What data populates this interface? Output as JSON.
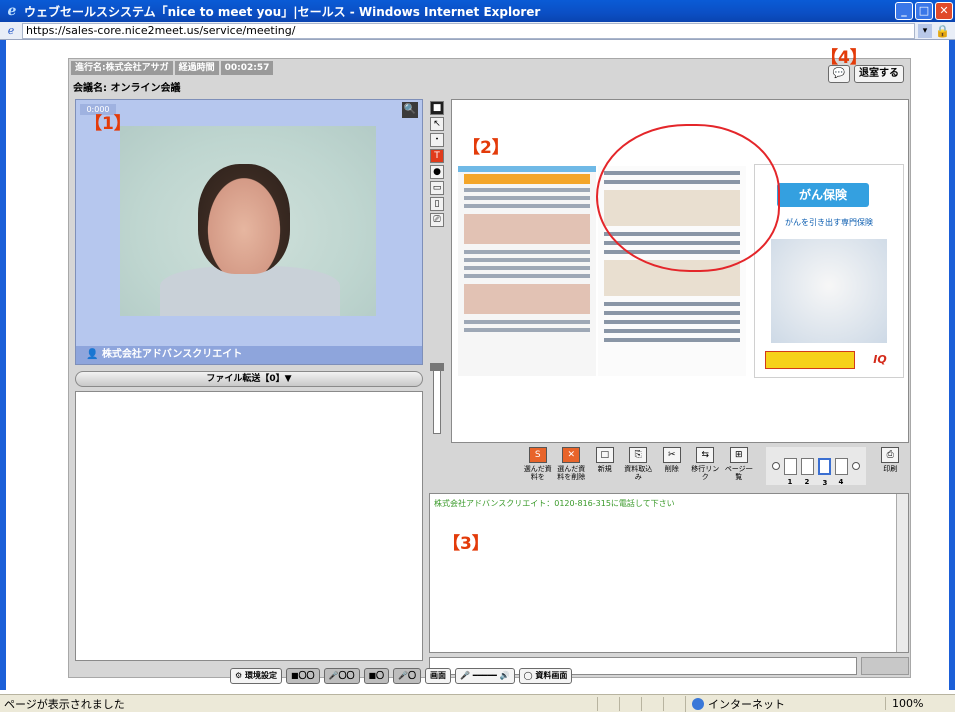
{
  "window": {
    "title": "ウェブセールスシステム「nice to meet you」|セールス - Windows Internet Explorer",
    "url": "https://sales-core.nice2meet.us/service/meeting/"
  },
  "header": {
    "chips": [
      "進行名:株式会社アサガ",
      "経過時間",
      "00:02:57"
    ],
    "meeting_name": "会議名: オンライン会議",
    "chat_icon": "💬",
    "leave_button": "退室する"
  },
  "markers": {
    "m1": "【1】",
    "m2": "【2】",
    "m3": "【3】",
    "m4": "【4】"
  },
  "video": {
    "timer": "0:000",
    "zoom_icon": "🔍",
    "participant": "株式会社アドバンスクリエイト"
  },
  "file_bar": {
    "label": "ファイル転送【0】▼"
  },
  "tools": [
    "■",
    "↖",
    "・",
    "T",
    "●",
    "▭",
    "▯",
    "⎚"
  ],
  "slider": {
    "max": "100%",
    "min": "50%"
  },
  "document": {
    "brand": "がん保険",
    "subtitle": "がんを引き出す専門保険",
    "corner_mark": "IQ"
  },
  "page_toolbar": {
    "buttons": [
      {
        "icon": "S",
        "label": "選んだ資料を"
      },
      {
        "icon": "✕",
        "label": "選んだ資料を削除"
      },
      {
        "icon": "□",
        "label": "新規"
      },
      {
        "icon": "⎘",
        "label": "資料取込み"
      },
      {
        "icon": "✂",
        "label": "削除"
      },
      {
        "icon": "⇆",
        "label": "移行リンク"
      },
      {
        "icon": "⊞",
        "label": "ページ一覧"
      }
    ],
    "pages": [
      "1",
      "2",
      "3",
      "4"
    ],
    "print": "印刷"
  },
  "chat": {
    "line": "株式会社アドバンスクリエイト：0120-816-315に電話して下さい"
  },
  "controls": [
    "⚙ 環境設定",
    "■〇〇",
    "🎤〇〇",
    "■〇",
    "🎤〇",
    "画面",
    "🎤 ━━━━━ 🔊",
    "◯ 資料画面"
  ],
  "status": {
    "message": "ページが表示されました",
    "zone": "インターネット",
    "zoom": "100%"
  }
}
